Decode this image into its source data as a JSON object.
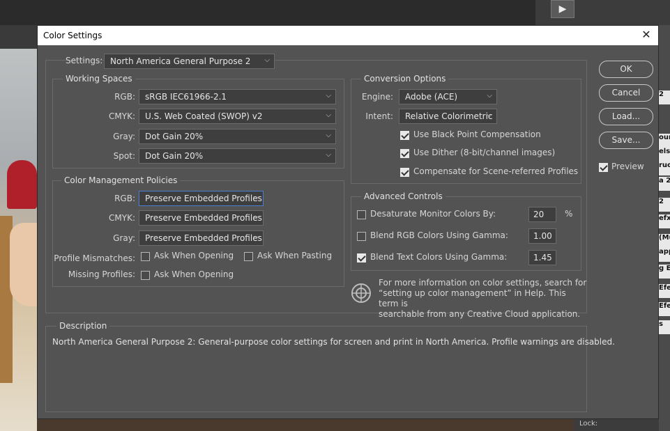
{
  "dialog": {
    "title": "Color Settings",
    "close_glyph": "✕"
  },
  "settings": {
    "label": "Settings:",
    "value": "North America General Purpose 2"
  },
  "working_spaces": {
    "legend": "Working Spaces",
    "rows": [
      {
        "label": "RGB:",
        "value": "sRGB IEC61966-2.1"
      },
      {
        "label": "CMYK:",
        "value": "U.S. Web Coated (SWOP) v2"
      },
      {
        "label": "Gray:",
        "value": "Dot Gain 20%"
      },
      {
        "label": "Spot:",
        "value": "Dot Gain 20%"
      }
    ]
  },
  "policies": {
    "legend": "Color Management Policies",
    "rows": [
      {
        "label": "RGB:",
        "value": "Preserve Embedded Profiles"
      },
      {
        "label": "CMYK:",
        "value": "Preserve Embedded Profiles"
      },
      {
        "label": "Gray:",
        "value": "Preserve Embedded Profiles"
      }
    ],
    "profile_mismatches": {
      "label": "Profile Mismatches:",
      "ask_opening": {
        "label": "Ask When Opening",
        "checked": false
      },
      "ask_pasting": {
        "label": "Ask When Pasting",
        "checked": false
      }
    },
    "missing_profiles": {
      "label": "Missing Profiles:",
      "ask_opening": {
        "label": "Ask When Opening",
        "checked": false
      }
    }
  },
  "conversion": {
    "legend": "Conversion Options",
    "engine": {
      "label": "Engine:",
      "value": "Adobe (ACE)"
    },
    "intent": {
      "label": "Intent:",
      "value": "Relative Colorimetric"
    },
    "options": [
      {
        "label": "Use Black Point Compensation",
        "checked": true
      },
      {
        "label": "Use Dither (8-bit/channel images)",
        "checked": true
      },
      {
        "label": "Compensate for Scene-referred Profiles",
        "checked": true
      }
    ]
  },
  "advanced": {
    "legend": "Advanced Controls",
    "desaturate": {
      "label": "Desaturate Monitor Colors By:",
      "checked": false,
      "value": "20",
      "unit": "%"
    },
    "blend_rgb": {
      "label": "Blend RGB Colors Using Gamma:",
      "checked": false,
      "value": "1.00"
    },
    "blend_text": {
      "label": "Blend Text Colors Using Gamma:",
      "checked": true,
      "value": "1.45"
    }
  },
  "info": {
    "line1": "For more information on color settings, search for",
    "line2": "“setting up color management” in Help. This term is",
    "line3": "searchable from any Creative Cloud application."
  },
  "description": {
    "legend": "Description",
    "text": "North America General Purpose 2:  General-purpose color settings for screen and print in North America. Profile warnings are disabled."
  },
  "buttons": {
    "ok": "OK",
    "cancel": "Cancel",
    "load": "Load...",
    "save": "Save...",
    "preview": {
      "label": "Preview",
      "checked": true
    }
  },
  "background": {
    "play_glyph": "▶",
    "right_cells": [
      "2",
      "our",
      "els",
      "ruc",
      "a 2",
      "2",
      "efx",
      "(Mu",
      "app",
      "g E",
      "Efe",
      "Efe",
      "s"
    ],
    "lock_label": "Lock:"
  }
}
